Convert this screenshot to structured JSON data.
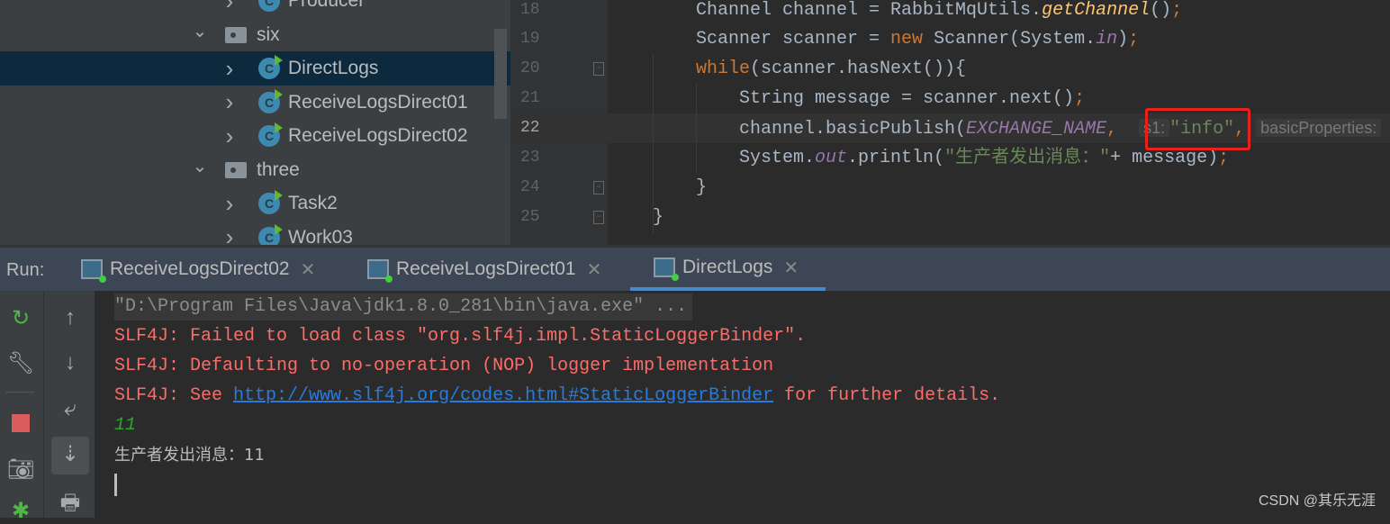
{
  "tree": {
    "items": [
      {
        "label": "Producer",
        "type": "class",
        "expanded": false,
        "level": 3
      },
      {
        "label": "six",
        "type": "folder",
        "expanded": true,
        "level": 2
      },
      {
        "label": "DirectLogs",
        "type": "class",
        "expanded": false,
        "level": 3,
        "selected": true
      },
      {
        "label": "ReceiveLogsDirect01",
        "type": "class",
        "expanded": false,
        "level": 3
      },
      {
        "label": "ReceiveLogsDirect02",
        "type": "class",
        "expanded": false,
        "level": 3
      },
      {
        "label": "three",
        "type": "folder",
        "expanded": true,
        "level": 2
      },
      {
        "label": "Task2",
        "type": "class",
        "expanded": false,
        "level": 3
      },
      {
        "label": "Work03",
        "type": "class",
        "expanded": false,
        "level": 3
      }
    ],
    "class_icon_letter": "C"
  },
  "editor": {
    "current_line": "22",
    "lines": [
      {
        "n": "18"
      },
      {
        "n": "19"
      },
      {
        "n": "20"
      },
      {
        "n": "21"
      },
      {
        "n": "22"
      },
      {
        "n": "23"
      },
      {
        "n": "24"
      },
      {
        "n": "25"
      }
    ],
    "code": {
      "l18a": "Channel channel = RabbitMqUtils.",
      "l18b": "getChannel",
      "l18c": "()",
      "l18d": ";",
      "l19a": "Scanner scanner = ",
      "l19b": "new",
      "l19c": " Scanner(System.",
      "l19d": "in",
      "l19e": ")",
      "l19f": ";",
      "l20a": "while",
      "l20b": "(scanner.hasNext()){",
      "l21a": "String message = scanner.next()",
      "l21b": ";",
      "l22a": "channel.basicPublish(",
      "l22b": "EXCHANGE_NAME",
      "l22c": ", ",
      "l22hint1": "s1:",
      "l22d": "\"info\"",
      "l22e": ",",
      "l22hint2": "basicProperties:",
      "l23a": "System.",
      "l23b": "out",
      "l23c": ".println(",
      "l23d": "\"生产者发出消息：\"",
      "l23e": "+ message)",
      "l23f": ";",
      "l24": "}",
      "l25": "}"
    },
    "highlight_color": "#e8211c"
  },
  "run": {
    "label": "Run:",
    "tabs": [
      {
        "label": "ReceiveLogsDirect02",
        "active": false
      },
      {
        "label": "ReceiveLogsDirect01",
        "active": false
      },
      {
        "label": "DirectLogs",
        "active": true
      }
    ]
  },
  "toolbar": {
    "left": [
      "rerun-icon",
      "wrench-icon",
      "stop-icon",
      "camera-icon",
      "debug-icon"
    ],
    "right": [
      "up-arrow-icon",
      "down-arrow-icon",
      "soft-wrap-icon",
      "scroll-to-end-icon",
      "print-icon"
    ]
  },
  "console": {
    "cmd": "\"D:\\Program Files\\Java\\jdk1.8.0_281\\bin\\java.exe\" ...",
    "err1": "SLF4J: Failed to load class \"org.slf4j.impl.StaticLoggerBinder\".",
    "err2": "SLF4J: Defaulting to no-operation (NOP) logger implementation",
    "err3a": "SLF4J: See ",
    "err3link": "http://www.slf4j.org/codes.html#StaticLoggerBinder",
    "err3b": " for further details.",
    "input": "11",
    "output": "生产者发出消息：11"
  },
  "watermark": "CSDN @其乐无涯"
}
